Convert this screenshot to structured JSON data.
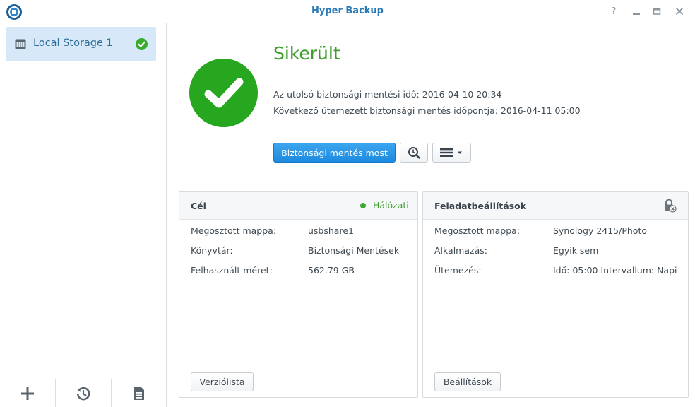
{
  "window": {
    "title": "Hyper Backup",
    "controls": [
      "help-icon",
      "minimize-icon",
      "maximize-icon",
      "close-icon"
    ]
  },
  "sidebar": {
    "items": [
      {
        "label": "Local Storage 1",
        "icon": "storage-icon",
        "status_icon": "check-circle-icon",
        "selected": true
      }
    ],
    "footer": [
      "add-icon",
      "restore-history-icon",
      "log-icon"
    ]
  },
  "status": {
    "title": "Sikerült",
    "last_backup": "Az utolsó biztonsági mentési idő: 2016-04-10 20:34",
    "next_backup": "Következő ütemezett biztonsági mentés időpontja: 2016-04-11 05:00",
    "color": "#27a61f"
  },
  "actions": {
    "backup_now": "Biztonsági mentés most"
  },
  "target": {
    "title": "Cél",
    "status": "Hálózati",
    "status_color": "#3aab2f",
    "rows": [
      {
        "label": "Megosztott mappa:",
        "value": "usbshare1"
      },
      {
        "label": "Könyvtár:",
        "value": "Biztonsági Mentések"
      },
      {
        "label": "Felhasznált méret:",
        "value": "562.79 GB"
      }
    ],
    "button": "Verziólista"
  },
  "task": {
    "title": "Feladatbeállítások",
    "rows": [
      {
        "label": "Megosztott mappa:",
        "value": "Synology 2415/Photo"
      },
      {
        "label": "Alkalmazás:",
        "value": "Egyik sem"
      },
      {
        "label": "Ütemezés:",
        "value": "Idő: 05:00 Intervallum: Napi"
      }
    ],
    "button": "Beállítások"
  },
  "colors": {
    "accent": "#2a7ab8",
    "primary_button": "#1d8ae0",
    "selected_item": "#d7e9f8"
  }
}
